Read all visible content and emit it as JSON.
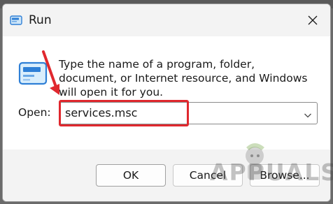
{
  "window": {
    "title": "Run",
    "description": "Type the name of a program, folder, document, or Internet resource, and Windows will open it for you."
  },
  "open_field": {
    "label": "Open:",
    "value": "services.msc"
  },
  "buttons": {
    "ok": "OK",
    "cancel": "Cancel",
    "browse": "Browse..."
  },
  "icons": {
    "app": "run-icon",
    "close": "close-icon",
    "dropdown": "chevron-down-icon",
    "annotation": "red-arrow-annotation"
  },
  "colors": {
    "accent": "#2e7fd6",
    "annotation": "#e0282e",
    "titlebar": "#f3f3f3"
  },
  "watermark": {
    "text": "APPUALS"
  }
}
